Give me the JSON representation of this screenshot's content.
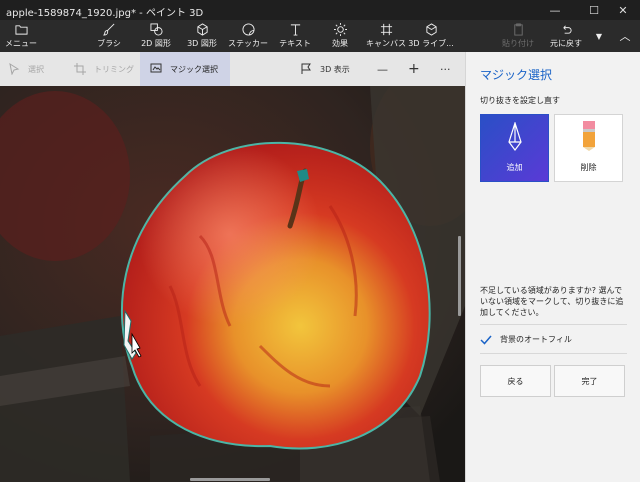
{
  "window": {
    "title": "apple-1589874_1920.jpg* - ペイント 3D"
  },
  "ribbon": {
    "menu": "メニュー",
    "brush": "ブラシ",
    "shapes2d": "2D 図形",
    "shapes3d": "3D 図形",
    "stickers": "ステッカー",
    "text": "テキスト",
    "effects": "効果",
    "canvas": "キャンバス",
    "library3d": "3D ライブ...",
    "paste": "貼り付け",
    "undo": "元に戻す"
  },
  "toolbar": {
    "select": "選択",
    "crop": "トリミング",
    "magic_select": "マジック選択",
    "view3d": "3D 表示",
    "zoom_out": "—",
    "zoom_in": "+",
    "more": "···"
  },
  "panel": {
    "title": "マジック選択",
    "subtitle": "切り抜きを設定し直す",
    "add": "追加",
    "remove": "削除",
    "hint": "不足している領域がありますか? 選んでいない領域をマークして、切り抜きに追加してください。",
    "autofill": "背景のオートフィル",
    "autofill_checked": true,
    "back": "戻る",
    "done": "完了"
  },
  "colors": {
    "accent": "#1a63c7",
    "selected_card": "#3d45cf"
  }
}
